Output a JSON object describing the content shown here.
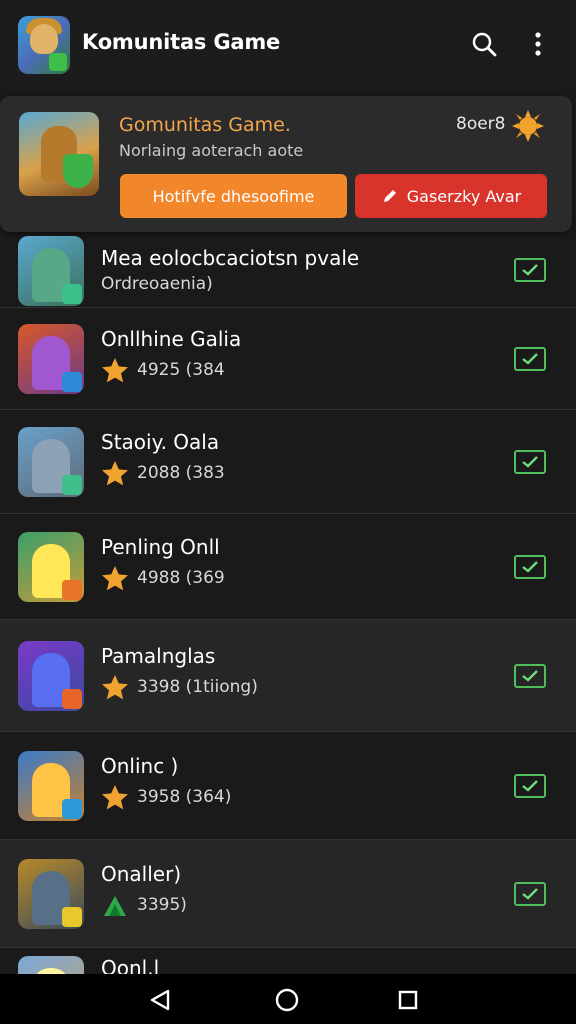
{
  "app_bar": {
    "title": "Komunitas Game",
    "icons": [
      "search-icon",
      "more-vert-icon"
    ]
  },
  "featured": {
    "title": "Gomunitas Game.",
    "subtitle": "Norlaing aoterach aote",
    "count": "8oer8",
    "primary_button": "Hotifvfe dhesoofime",
    "secondary_button": "Gaserzky Avar",
    "colors": {
      "primary": "#f2862a",
      "secondary": "#d9342b",
      "accent_text": "#f3a64a"
    }
  },
  "list": {
    "items": [
      {
        "title": "Mea eolocbcaciotsn pvale",
        "subtitle": "Ordreoaenia)",
        "rating": null
      },
      {
        "title": "Onllhine Galia",
        "subtitle": "4925 (384",
        "rating": "star"
      },
      {
        "title": "Staoiy. Oala",
        "subtitle": "2088 (383",
        "rating": "star"
      },
      {
        "title": "Penling Onll",
        "subtitle": "4988 (369",
        "rating": "star"
      },
      {
        "title": "Pamalnglas",
        "subtitle": "3398 (1tiiong)",
        "rating": "star"
      },
      {
        "title": "Onlinc )",
        "subtitle": "3958 (364)",
        "rating": "star"
      },
      {
        "title": "Onaller)",
        "subtitle": "3395)",
        "rating": "up-arrow"
      },
      {
        "title": "Oonl.l",
        "subtitle": "",
        "rating": null
      }
    ]
  },
  "nav": {
    "icons": [
      "back-icon",
      "home-icon",
      "recents-icon"
    ]
  }
}
